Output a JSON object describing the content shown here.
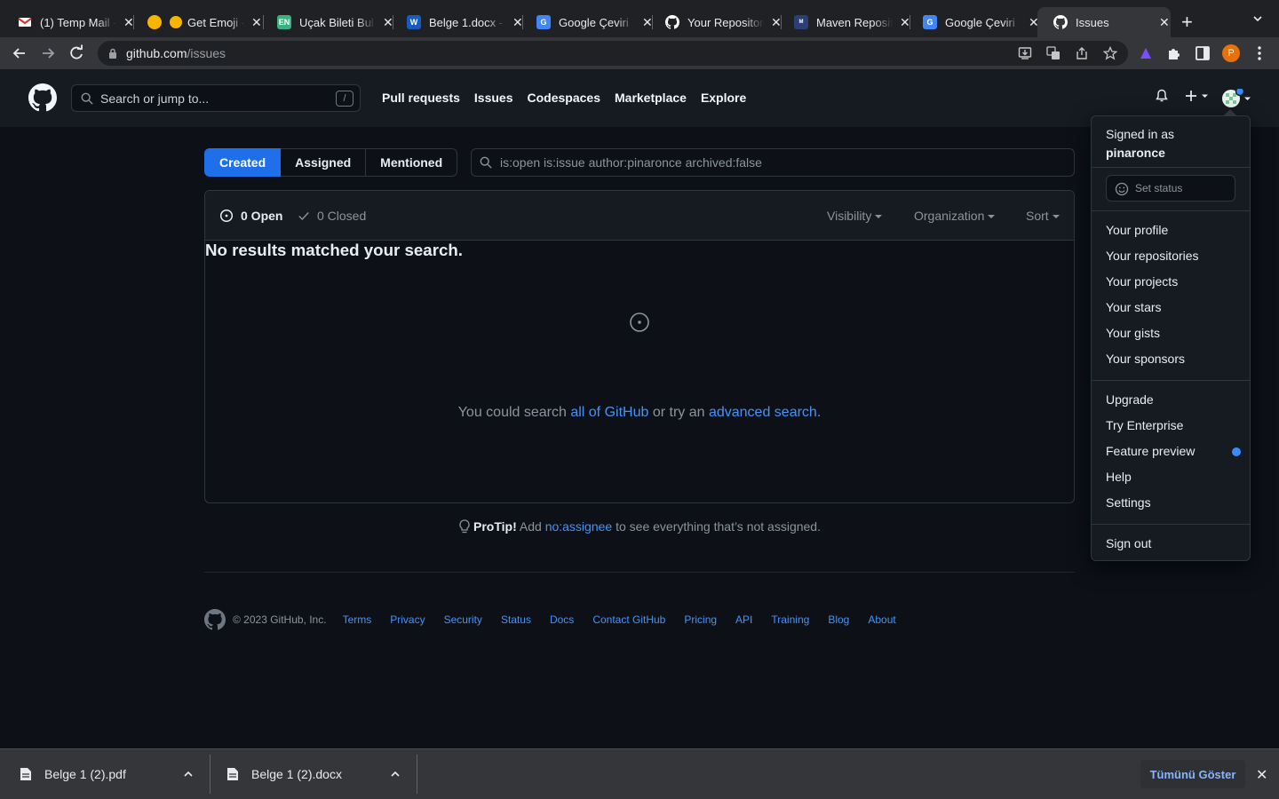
{
  "browser": {
    "tabs": [
      {
        "title": "(1) Temp Mail - ",
        "icon": "gmail-icon",
        "color": "#d93025"
      },
      {
        "title": "Get Emoji - ",
        "icon": "emoji-icon",
        "color": "#f7b500"
      },
      {
        "title": "Uçak Bileti Bul",
        "icon": "enuygun-icon",
        "color": "#36b37e",
        "fav_text": "EN"
      },
      {
        "title": "Belge 1.docx - ",
        "icon": "word-icon",
        "color": "#185abd",
        "fav_text": "W"
      },
      {
        "title": "Google Çeviri",
        "icon": "google-translate-icon",
        "color": "#4285f4"
      },
      {
        "title": "Your Repositor",
        "icon": "github-icon",
        "color": "#ffffff"
      },
      {
        "title": "Maven Reposit",
        "icon": "maven-icon",
        "color": "#2c3e73"
      },
      {
        "title": "Google Çeviri",
        "icon": "google-translate-icon",
        "color": "#4285f4"
      },
      {
        "title": "Issues",
        "icon": "github-icon",
        "color": "#ffffff"
      }
    ],
    "url_host": "github.com",
    "url_path": "/issues",
    "profile_initial": "P"
  },
  "header": {
    "search_placeholder": "Search or jump to...",
    "search_shortcut": "/",
    "nav": [
      "Pull requests",
      "Issues",
      "Codespaces",
      "Marketplace",
      "Explore"
    ]
  },
  "subnav": {
    "created": "Created",
    "assigned": "Assigned",
    "mentioned": "Mentioned"
  },
  "filter_query": "is:open is:issue author:pinaronce archived:false",
  "box": {
    "open_label": "0 Open",
    "closed_label": "0 Closed",
    "visibility": "Visibility",
    "organization": "Organization",
    "sort": "Sort"
  },
  "blankslate": {
    "title": "No results matched your search.",
    "text_before": "You could search ",
    "link1": "all of GitHub",
    "text_middle": " or try an ",
    "link2": "advanced search",
    "text_after": "."
  },
  "protip": {
    "label": "ProTip!",
    "before": " Add ",
    "link": "no:assignee",
    "after": " to see everything that’s not assigned."
  },
  "footer": {
    "copyright": "© 2023 GitHub, Inc.",
    "links": [
      "Terms",
      "Privacy",
      "Security",
      "Status",
      "Docs",
      "Contact GitHub",
      "Pricing",
      "API",
      "Training",
      "Blog",
      "About"
    ]
  },
  "user_menu": {
    "signed_in_as": "Signed in as",
    "username": "pinaronce",
    "set_status": "Set status",
    "group1": [
      "Your profile",
      "Your repositories",
      "Your projects",
      "Your stars",
      "Your gists",
      "Your sponsors"
    ],
    "group2": [
      "Upgrade",
      "Try Enterprise",
      "Feature preview",
      "Help",
      "Settings"
    ],
    "sign_out": "Sign out"
  },
  "downloads": {
    "items": [
      "Belge 1 (2).pdf",
      "Belge 1 (2).docx"
    ],
    "show_all": "Tümünü Göster"
  },
  "colors": {
    "accent": "#1f6feb",
    "link": "#4493f8",
    "background": "#0d1117",
    "feature_dot": "#388bfd"
  }
}
